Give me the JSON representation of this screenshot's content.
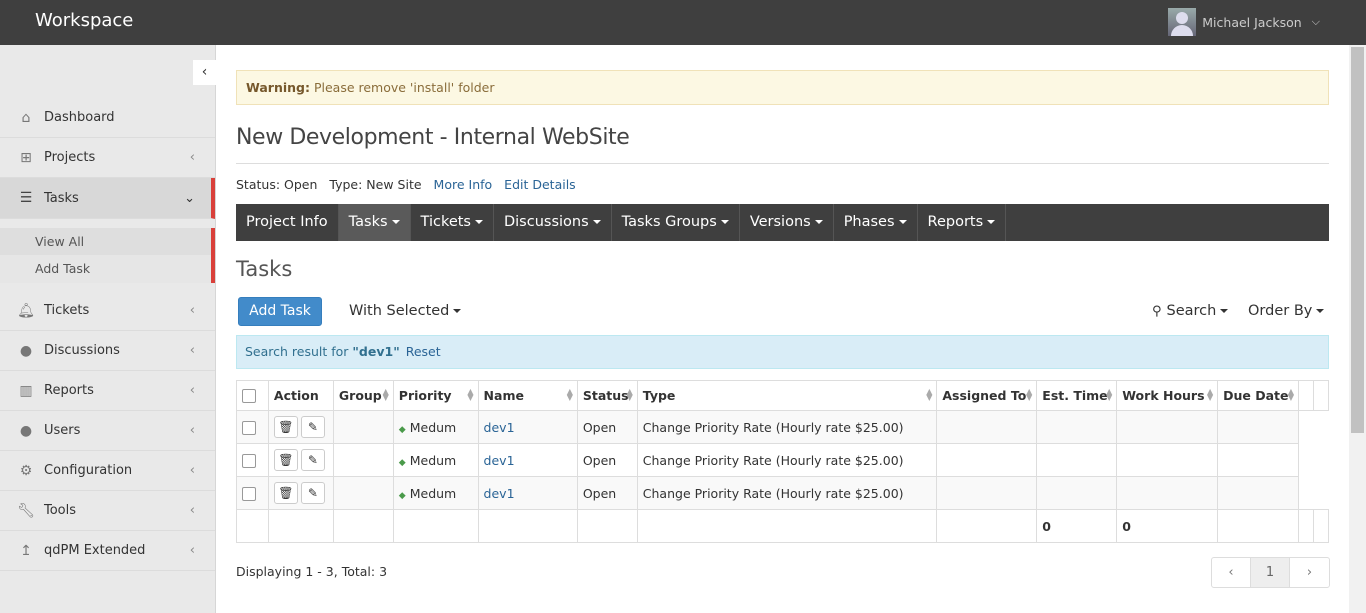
{
  "app": {
    "title": "Workspace"
  },
  "user": {
    "name": "Michael Jackson",
    "caret": "⌵"
  },
  "sidebar": {
    "items": [
      {
        "label": "Dashboard",
        "icon": "home-icon"
      },
      {
        "label": "Projects",
        "icon": "sitemap-icon"
      },
      {
        "label": "Tasks",
        "icon": "tasks-icon"
      },
      {
        "label": "Tickets",
        "icon": "bell-icon"
      },
      {
        "label": "Discussions",
        "icon": "comments-icon"
      },
      {
        "label": "Reports",
        "icon": "bar-chart-icon"
      },
      {
        "label": "Users",
        "icon": "user-icon"
      },
      {
        "label": "Configuration",
        "icon": "gear-icon"
      },
      {
        "label": "Tools",
        "icon": "wrench-icon"
      },
      {
        "label": "qdPM Extended",
        "icon": "level-up-icon"
      }
    ],
    "sub": [
      "View All",
      "Add Task"
    ]
  },
  "warning": {
    "strong": "Warning:",
    "text": " Please remove 'install' folder"
  },
  "project": {
    "title": "New Development - Internal WebSite",
    "status": "Status: Open",
    "type": "Type: New Site",
    "more_info": "More Info",
    "edit_details": "Edit Details"
  },
  "project_nav": [
    "Project Info",
    "Tasks",
    "Tickets",
    "Discussions",
    "Tasks Groups",
    "Versions",
    "Phases",
    "Reports"
  ],
  "section_title": "Tasks",
  "toolbar": {
    "add_task": "Add Task",
    "with_selected": "With Selected",
    "search": "Search",
    "order_by": "Order By"
  },
  "search_result": {
    "prefix": "Search result for ",
    "query": "\"dev1\"",
    "reset": "Reset"
  },
  "table": {
    "headers": [
      "Action",
      "Group",
      "Priority",
      "Name",
      "Status",
      "Type",
      "Assigned To",
      "Est. Time",
      "Work Hours",
      "Due Date"
    ],
    "rows": [
      {
        "priority": "Medum",
        "name": "dev1",
        "status": "Open",
        "type": "Change Priority Rate (Hourly rate $25.00)"
      },
      {
        "priority": "Medum",
        "name": "dev1",
        "status": "Open",
        "type": "Change Priority Rate (Hourly rate $25.00)"
      },
      {
        "priority": "Medum",
        "name": "dev1",
        "status": "Open",
        "type": "Change Priority Rate (Hourly rate $25.00)"
      }
    ],
    "totals": {
      "est_time": "0",
      "work_hours": "0"
    }
  },
  "footer": {
    "displaying": "Displaying 1 - 3, Total: 3",
    "page": "1",
    "prev": "‹",
    "next": "›"
  }
}
